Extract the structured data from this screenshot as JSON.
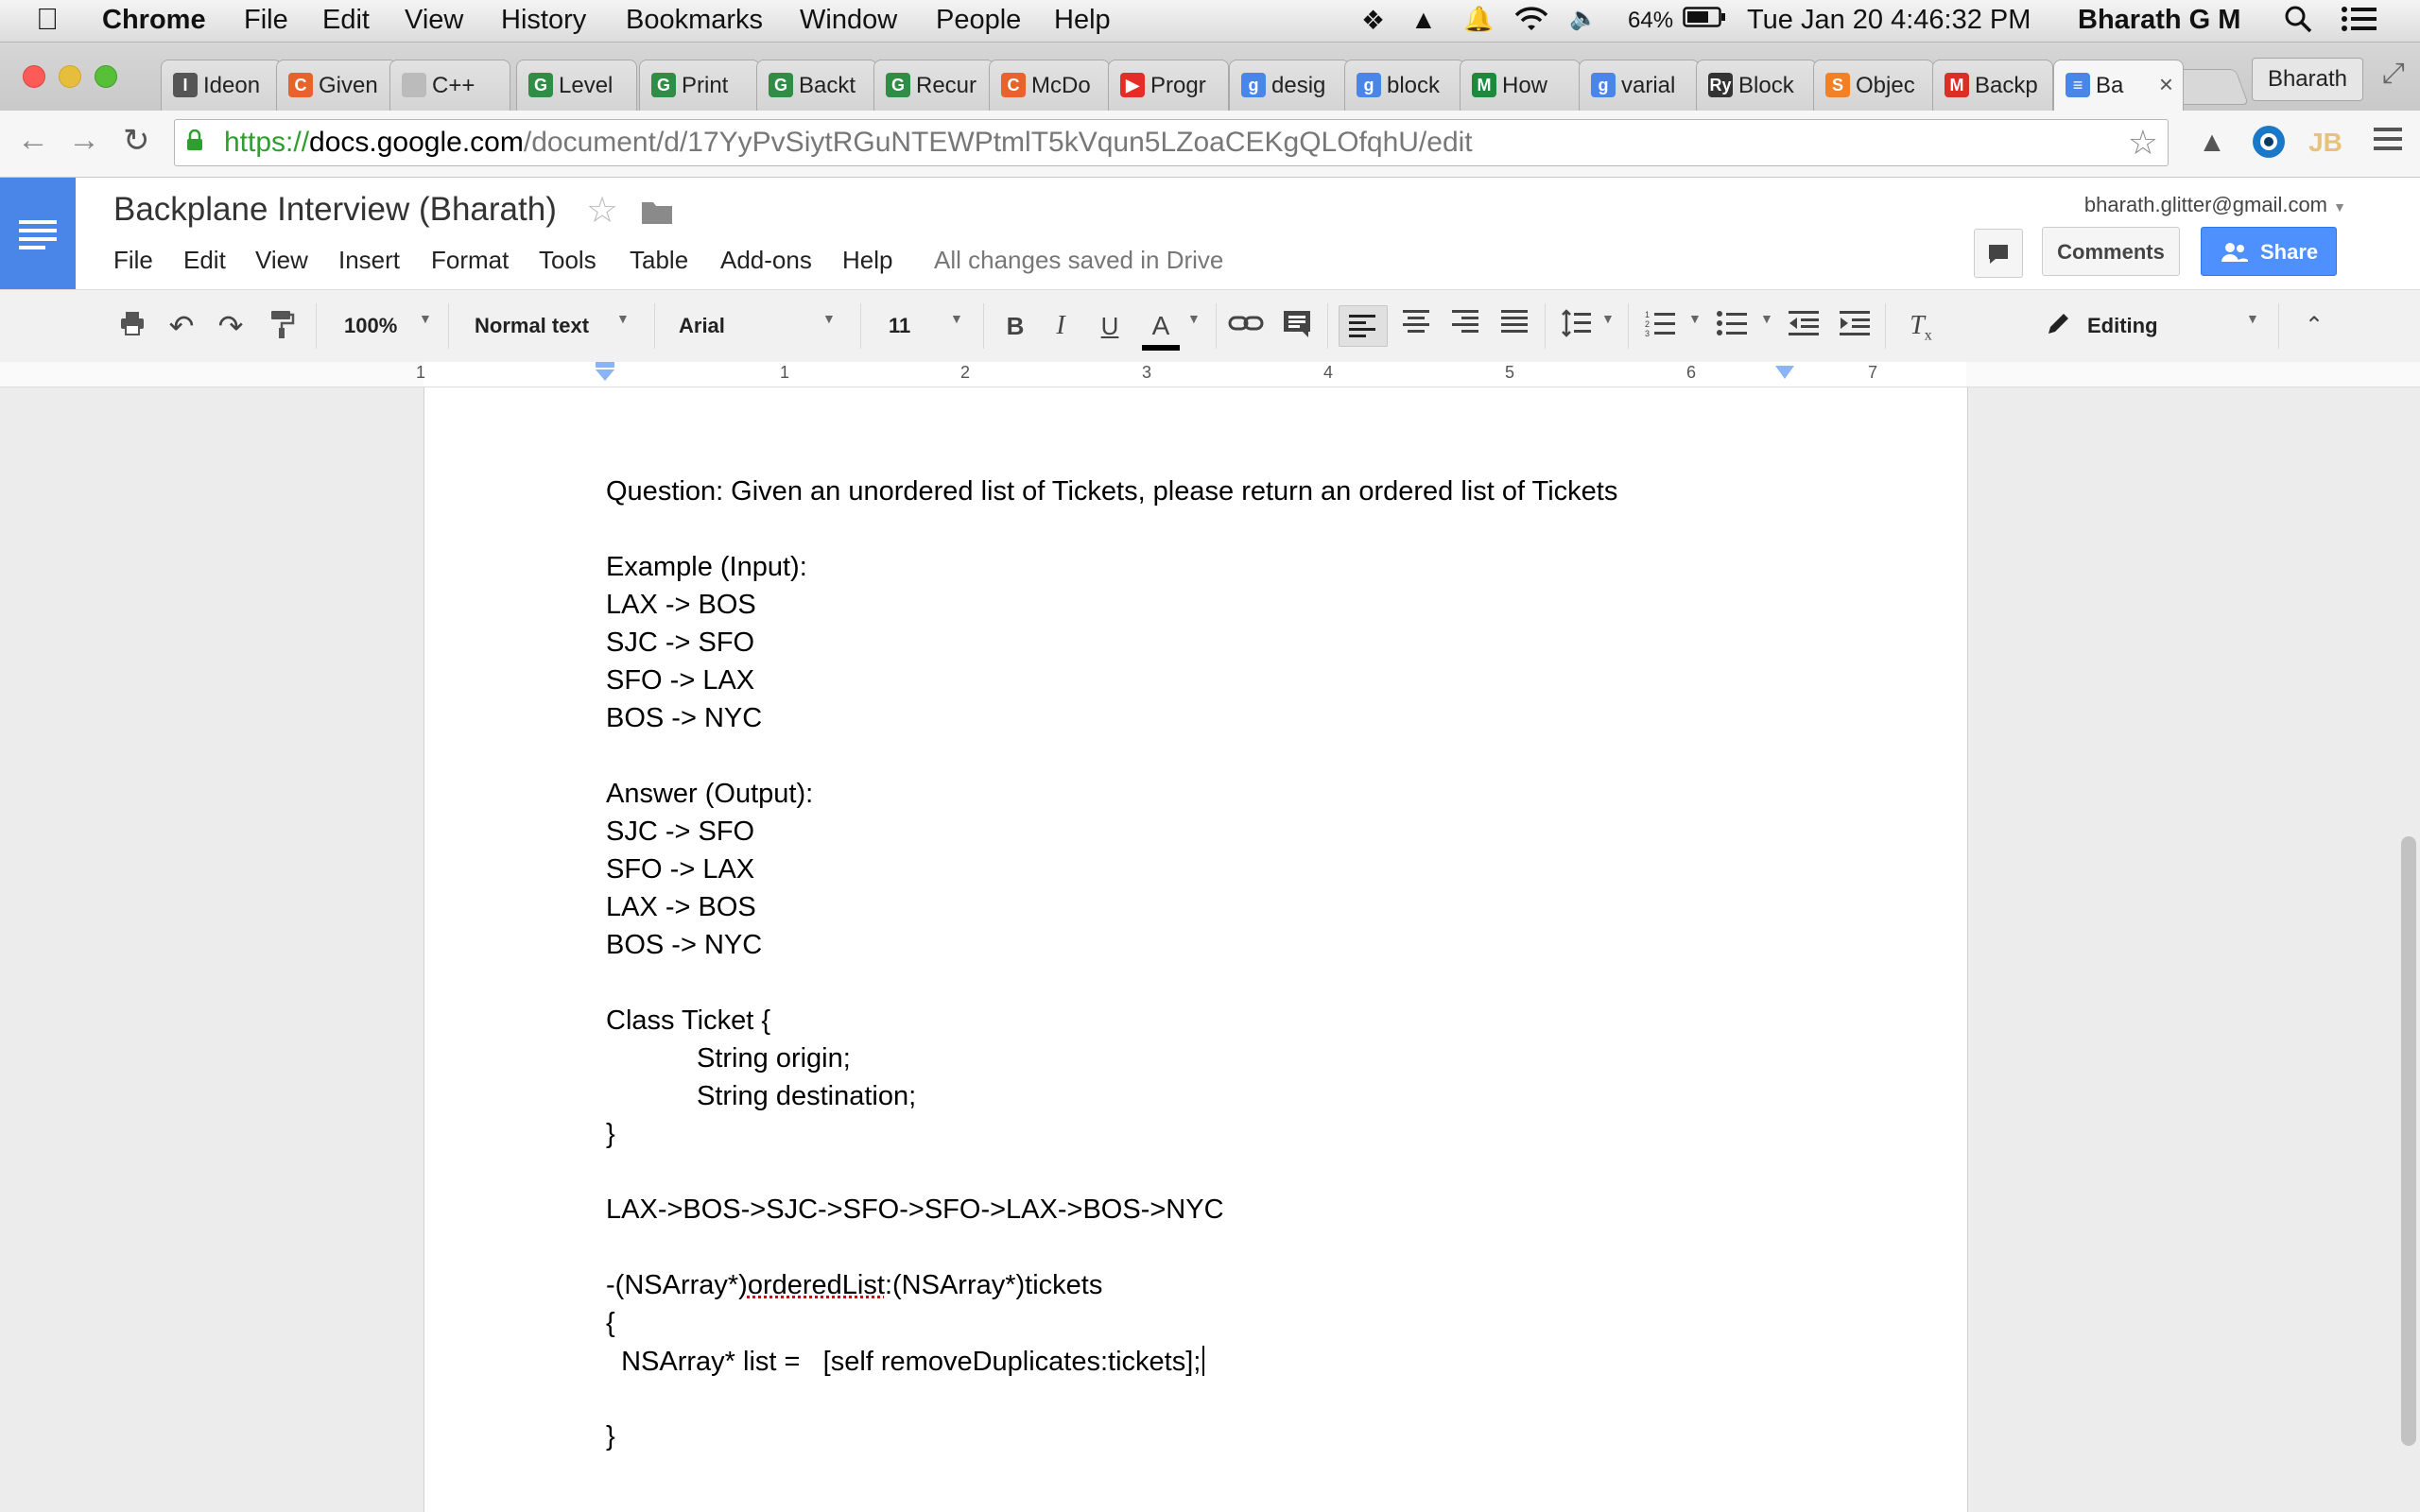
{
  "menubar": {
    "app": "Chrome",
    "items": [
      "File",
      "Edit",
      "View",
      "History",
      "Bookmarks",
      "Window",
      "People",
      "Help"
    ],
    "battery": "64%",
    "datetime": "Tue Jan 20  4:46:32 PM",
    "user": "Bharath G M"
  },
  "tabs": [
    {
      "label": "Ideon",
      "favicon": "ideone-icon",
      "color": "#555555",
      "glyph": "I"
    },
    {
      "label": "Given",
      "favicon": "careercup-icon",
      "color": "#e8632b",
      "glyph": "C"
    },
    {
      "label": "C++",
      "favicon": "page-icon",
      "color": "#bbbbbb",
      "glyph": ""
    },
    {
      "label": "Level",
      "favicon": "geeksforgeeks-icon",
      "color": "#2f8d46",
      "glyph": "G"
    },
    {
      "label": "Print",
      "favicon": "geeksforgeeks-icon",
      "color": "#2f8d46",
      "glyph": "G"
    },
    {
      "label": "Backt",
      "favicon": "geeksforgeeks-icon",
      "color": "#2f8d46",
      "glyph": "G"
    },
    {
      "label": "Recur",
      "favicon": "geeksforgeeks-icon",
      "color": "#2f8d46",
      "glyph": "G"
    },
    {
      "label": "McDo",
      "favicon": "careercup-icon",
      "color": "#e8632b",
      "glyph": "C"
    },
    {
      "label": "Progr",
      "favicon": "youtube-icon",
      "color": "#e52d27",
      "glyph": "▶"
    },
    {
      "label": "desig",
      "favicon": "google-search-icon",
      "color": "#4a86e8",
      "glyph": "g"
    },
    {
      "label": "block",
      "favicon": "google-search-icon",
      "color": "#4a86e8",
      "glyph": "g"
    },
    {
      "label": "How",
      "favicon": "medium-icon",
      "color": "#1b8a3d",
      "glyph": "M"
    },
    {
      "label": "varial",
      "favicon": "google-search-icon",
      "color": "#4a86e8",
      "glyph": "g"
    },
    {
      "label": "Block",
      "favicon": "raywenderlich-icon",
      "color": "#333333",
      "glyph": "Ry"
    },
    {
      "label": "Objec",
      "favicon": "stackoverflow-icon",
      "color": "#f48024",
      "glyph": "S"
    },
    {
      "label": "Backp",
      "favicon": "gmail-icon",
      "color": "#d93025",
      "glyph": "M"
    },
    {
      "label": "Ba",
      "favicon": "google-docs-icon",
      "color": "#4a86e8",
      "glyph": "≡",
      "active": true
    }
  ],
  "profile": "Bharath",
  "omnibox": {
    "scheme": "https://",
    "host": "docs.google.com",
    "path": "/document/d/17YyPvSiytRGuNTEWPtmlT5kVqun5LZoaCEKgQLOfqhU/edit"
  },
  "doc": {
    "title": "Backplane Interview (Bharath)",
    "menu": [
      "File",
      "Edit",
      "View",
      "Insert",
      "Format",
      "Tools",
      "Table",
      "Add-ons",
      "Help"
    ],
    "saved_status": "All changes saved in Drive",
    "account": "bharath.glitter@gmail.com",
    "comments_label": "Comments",
    "share_label": "Share"
  },
  "toolbar": {
    "zoom": "100%",
    "style": "Normal text",
    "font": "Arial",
    "size": "11",
    "mode": "Editing",
    "text_color": "#000000"
  },
  "ruler": [
    "1",
    "1",
    "2",
    "3",
    "4",
    "5",
    "6",
    "7"
  ],
  "document_lines": [
    {
      "text": "Question: Given an unordered list of Tickets, please return an ordered list of Tickets"
    },
    {
      "text": ""
    },
    {
      "text": "Example (Input):"
    },
    {
      "text": "LAX -> BOS"
    },
    {
      "text": "SJC -> SFO"
    },
    {
      "text": "SFO -> LAX"
    },
    {
      "text": "BOS -> NYC"
    },
    {
      "text": ""
    },
    {
      "text": "Answer (Output):"
    },
    {
      "text": "SJC -> SFO"
    },
    {
      "text": "SFO -> LAX"
    },
    {
      "text": "LAX -> BOS"
    },
    {
      "text": "BOS -> NYC"
    },
    {
      "text": ""
    },
    {
      "text": "Class Ticket {"
    },
    {
      "text": "String origin;",
      "indent": true
    },
    {
      "text": "String destination;",
      "indent": true
    },
    {
      "text": "}"
    },
    {
      "text": ""
    },
    {
      "text": "LAX->BOS->SJC->SFO->SFO->LAX->BOS->NYC"
    },
    {
      "text": ""
    },
    {
      "text": "-(NSArray*)orderedList:(NSArray*)tickets"
    },
    {
      "text": "{"
    },
    {
      "text": "  NSArray* list =   [self removeDuplicates:tickets];"
    },
    {
      "text": ""
    },
    {
      "text": "}"
    }
  ]
}
